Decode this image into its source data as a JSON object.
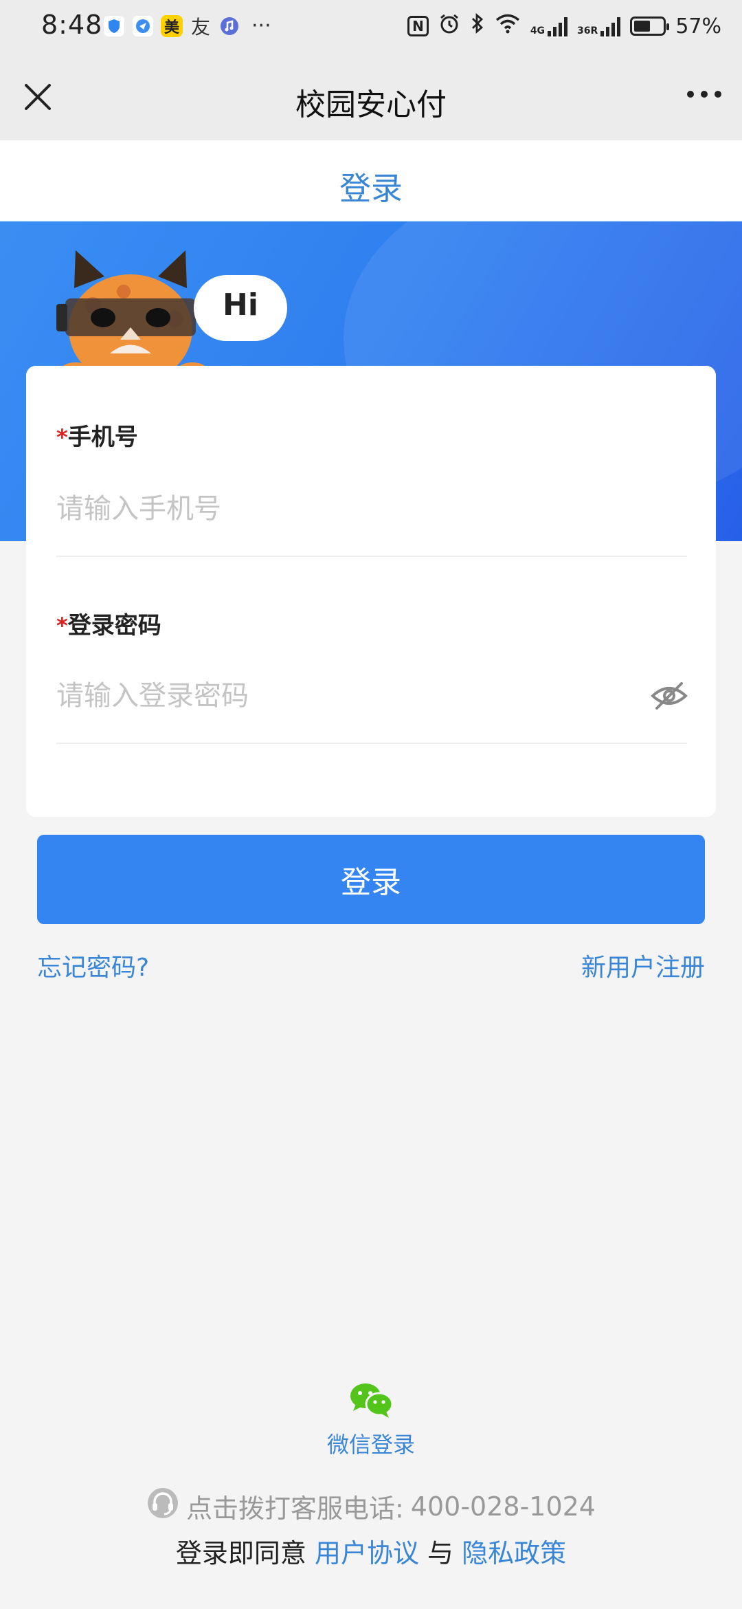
{
  "status_bar": {
    "time": "8:48",
    "app_badge_mei": "美",
    "app_badge_you": "友",
    "more": "···",
    "nfc": "N",
    "net_4g": "4G",
    "net_3g": "36R",
    "battery": "57%",
    "battery_level": 0.57
  },
  "nav": {
    "title": "校园安心付"
  },
  "tab": {
    "label": "登录"
  },
  "banner": {
    "greeting": "Hi",
    "accent": "#2f7ff0"
  },
  "form": {
    "required_mark": "*",
    "phone_label": "手机号",
    "phone_placeholder": "请输入手机号",
    "phone_value": "",
    "password_label": "登录密码",
    "password_placeholder": "请输入登录密码",
    "password_value": ""
  },
  "actions": {
    "login_button": "登录",
    "forgot_password": "忘记密码?",
    "register": "新用户注册"
  },
  "footer": {
    "wechat_login": "微信登录",
    "service_label": "点击拨打客服电话:",
    "service_phone": "400-028-1024",
    "agree_prefix": "登录即同意",
    "user_agreement": "用户协议",
    "and": "与",
    "privacy_policy": "隐私政策"
  },
  "colors": {
    "primary": "#3485f2",
    "link": "#3a86d6",
    "required": "#e02020",
    "wechat": "#52c41a"
  }
}
